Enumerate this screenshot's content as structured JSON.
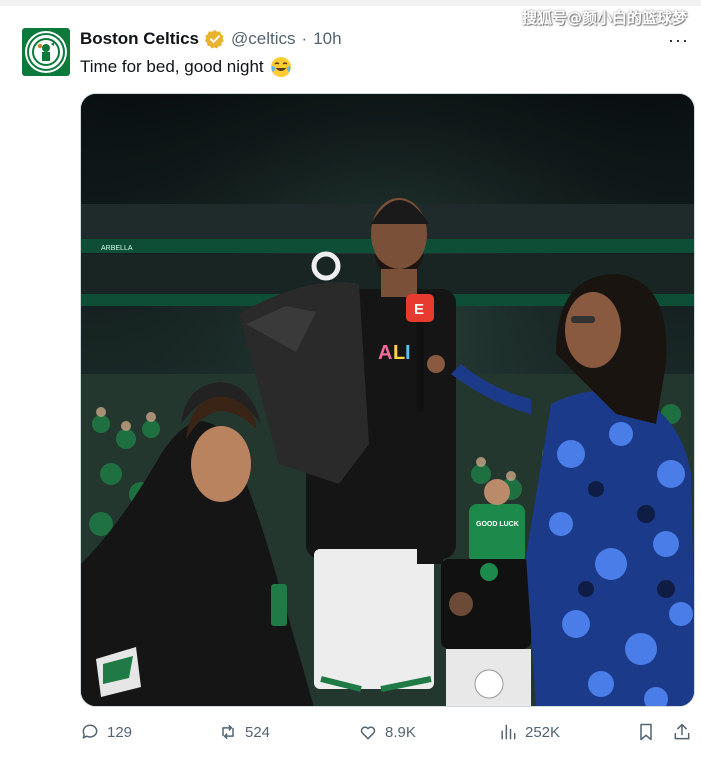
{
  "watermark": "搜狐号@颜小白的篮球梦",
  "tweet": {
    "author_name": "Boston Celtics",
    "handle": "@celtics",
    "separator": "·",
    "time": "10h",
    "text": "Time for bed, good night",
    "emoji": "face-with-tears-of-joy",
    "more_label": "···",
    "verified_color": "#e8b330"
  },
  "photo": {
    "banner_text": "ARBELLA",
    "jersey_text": "GOOD LUCK",
    "mic_flag": "E"
  },
  "actions": {
    "replies": "129",
    "reposts": "524",
    "likes": "8.9K",
    "views": "252K"
  }
}
